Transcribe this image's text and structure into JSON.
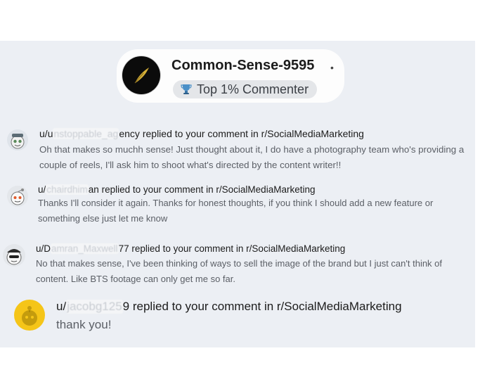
{
  "profile": {
    "username": "Common-Sense-9595",
    "separator": "•",
    "flair": "Top 1% Commenter"
  },
  "notifications": [
    {
      "prefix": "u/",
      "name_start": "u",
      "name_redacted": "nstoppable_ag",
      "name_end": "ency",
      "action": "replied to your comment in r/SocialMediaMarketing",
      "body": "Oh that makes so muchh sense! Just thought about it, I do have a photography team who's providing a couple of reels, I'll ask him to shoot what's directed by the content writer!!"
    },
    {
      "prefix": "u/",
      "name_start": "",
      "name_redacted": "chairdhim",
      "name_end": "an",
      "action": "replied to your comment in r/SocialMediaMarketing",
      "body": "Thanks I'll consider it again. Thanks for honest thoughts, if you think I should add a new feature or something else just let me know"
    },
    {
      "prefix": "u/",
      "name_start": "D",
      "name_redacted": "amran_Maxwell",
      "name_end": "77",
      "action": "replied to your comment in r/SocialMediaMarketing",
      "body": "No that makes sense, I've been thinking of ways to sell the image of the brand but I just can't think of content. Like BTS footage can only get me so far."
    },
    {
      "prefix": "u/",
      "name_start": "",
      "name_redacted": "jacobg125",
      "name_end": "9",
      "action": "replied to your comment in r/SocialMediaMarketing",
      "body": "thank you!"
    }
  ],
  "icons": {
    "profile": "feather-logo-icon",
    "flair": "trophy-icon",
    "avatars": [
      "snoo-avatar-icon",
      "snoo-avatar-icon",
      "snoo-avatar-icon",
      "snoo-yellow-avatar-icon"
    ]
  },
  "colors": {
    "panel_bg": "#eceff4",
    "chip_bg": "#fdfdfd",
    "text_primary": "#1c1c1c",
    "text_secondary": "#5b5f66",
    "snoo_yellow": "#f5c518"
  }
}
